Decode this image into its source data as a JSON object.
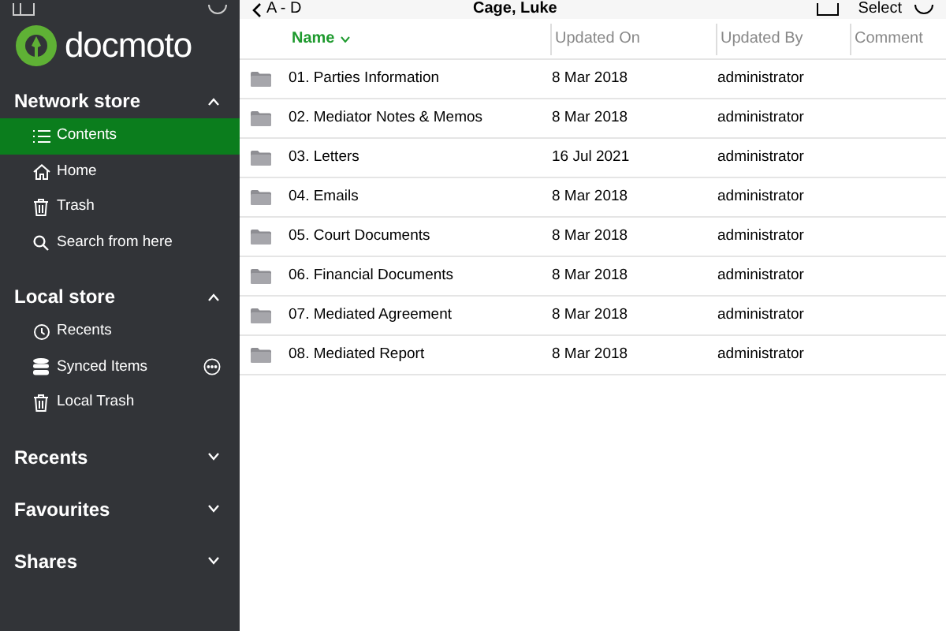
{
  "sidebar": {
    "logo": "docmoto",
    "sections": [
      {
        "title": "Network store",
        "expanded": true,
        "items": [
          {
            "label": "Contents",
            "kind": "list",
            "selected": true,
            "more": false
          },
          {
            "label": "Home",
            "kind": "home",
            "selected": false,
            "more": false
          },
          {
            "label": "Trash",
            "kind": "trash",
            "selected": false,
            "more": false
          },
          {
            "label": "Search from here",
            "kind": "search",
            "selected": false,
            "more": false
          }
        ]
      },
      {
        "title": "Local store",
        "expanded": true,
        "items": [
          {
            "label": "Recents",
            "kind": "clock",
            "selected": false,
            "more": false
          },
          {
            "label": "Synced Items",
            "kind": "database",
            "selected": false,
            "more": true
          },
          {
            "label": "Local Trash",
            "kind": "trash",
            "selected": false,
            "more": false
          }
        ]
      },
      {
        "title": "Recents",
        "expanded": false
      },
      {
        "title": "Favourites",
        "expanded": false
      },
      {
        "title": "Shares",
        "expanded": false
      }
    ]
  },
  "toolbar": {
    "back": "A - D",
    "title": "Cage, Luke",
    "select": "Select"
  },
  "table": {
    "columns": [
      {
        "label": "Name",
        "sorted": true
      },
      {
        "label": "Updated On",
        "sorted": false
      },
      {
        "label": "Updated By",
        "sorted": false
      },
      {
        "label": "Comment",
        "sorted": false
      }
    ],
    "rows": [
      {
        "name": "01. Parties Information",
        "updated_on": "8 Mar 2018",
        "updated_by": "administrator"
      },
      {
        "name": "02. Mediator Notes & Memos",
        "updated_on": "8 Mar 2018",
        "updated_by": "administrator"
      },
      {
        "name": "03. Letters",
        "updated_on": "16 Jul 2021",
        "updated_by": "administrator"
      },
      {
        "name": "04. Emails",
        "updated_on": "8 Mar 2018",
        "updated_by": "administrator"
      },
      {
        "name": "05. Court Documents",
        "updated_on": "8 Mar 2018",
        "updated_by": "administrator"
      },
      {
        "name": "06. Financial Documents",
        "updated_on": "8 Mar 2018",
        "updated_by": "administrator"
      },
      {
        "name": "07. Mediated Agreement",
        "updated_on": "8 Mar 2018",
        "updated_by": "administrator"
      },
      {
        "name": "08. Mediated Report",
        "updated_on": "8 Mar 2018",
        "updated_by": "administrator"
      }
    ]
  }
}
